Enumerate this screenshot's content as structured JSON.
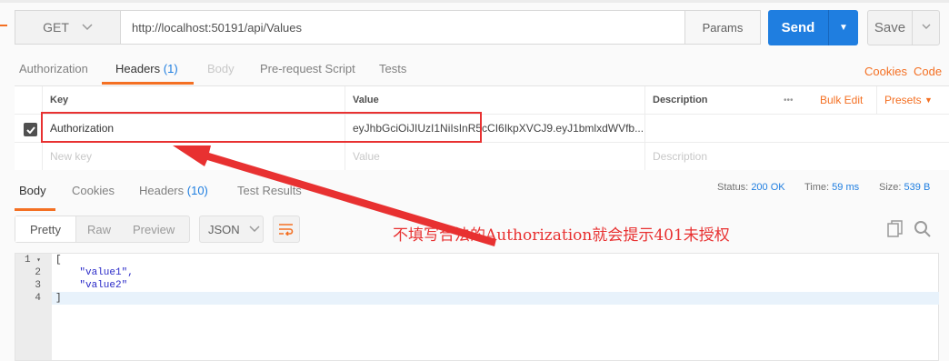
{
  "request": {
    "method": "GET",
    "url": "http://localhost:50191/api/Values",
    "params_label": "Params",
    "send_label": "Send",
    "save_label": "Save"
  },
  "request_tabs": [
    {
      "label": "Authorization",
      "count": ""
    },
    {
      "label": "Headers",
      "count": "(1)"
    },
    {
      "label": "Body",
      "count": ""
    },
    {
      "label": "Pre-request Script",
      "count": ""
    },
    {
      "label": "Tests",
      "count": ""
    }
  ],
  "links": {
    "cookies": "Cookies",
    "code": "Code"
  },
  "headers_table": {
    "columns": {
      "key": "Key",
      "value": "Value",
      "description": "Description"
    },
    "more": "•••",
    "bulk_edit": "Bulk Edit",
    "presets": "Presets",
    "rows": [
      {
        "key": "Authorization",
        "value": "eyJhbGciOiJIUzI1NiIsInR5cCI6IkpXVCJ9.eyJ1bmlxdWVfb...",
        "description": ""
      }
    ],
    "new_key_placeholder": "New key",
    "value_placeholder": "Value",
    "description_placeholder": "Description"
  },
  "response_tabs": [
    {
      "label": "Body",
      "count": ""
    },
    {
      "label": "Cookies",
      "count": ""
    },
    {
      "label": "Headers",
      "count": "(10)"
    },
    {
      "label": "Test Results",
      "count": ""
    }
  ],
  "status": {
    "status_label": "Status:",
    "status_value": "200 OK",
    "time_label": "Time:",
    "time_value": "59 ms",
    "size_label": "Size:",
    "size_value": "539 B"
  },
  "view_modes": [
    "Pretty",
    "Raw",
    "Preview"
  ],
  "format": "JSON",
  "code_lines": [
    {
      "n": "1",
      "text": "["
    },
    {
      "n": "2",
      "text": "    \"value1\","
    },
    {
      "n": "3",
      "text": "    \"value2\""
    },
    {
      "n": "4",
      "text": "]"
    }
  ],
  "annotation": "不填写合法的Authorization就会提示401未授权",
  "colors": {
    "accent": "#f47023",
    "send": "#1f7ee0",
    "annotation": "#e83131"
  }
}
